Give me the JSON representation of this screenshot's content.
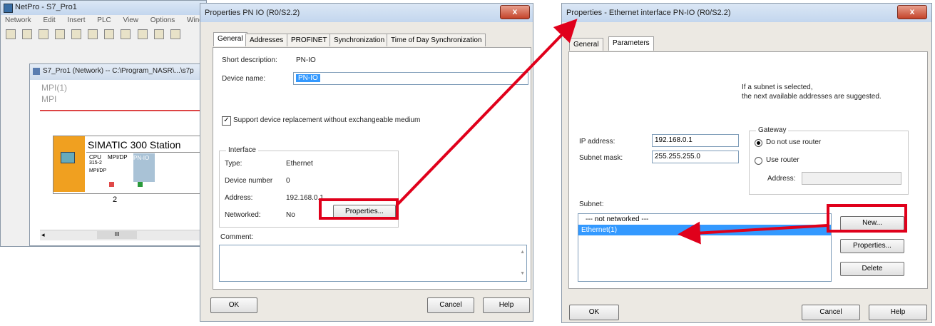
{
  "netpro": {
    "title": "NetPro - S7_Pro1",
    "menu": [
      "Network",
      "Edit",
      "Insert",
      "PLC",
      "View",
      "Options",
      "Window"
    ],
    "subwindow_title": "S7_Pro1 (Network) -- C:\\Program_NASR\\...\\s7p",
    "mpi_label": "MPI(1)",
    "mpi_sub": "MPI",
    "station_title": "SIMATIC 300 Station",
    "module_cpu": "CPU",
    "module_cpu_sub": "315-2",
    "module_mpidp": "MPI/DP",
    "module_mpidp2": "MPI/DP",
    "module_pnio": "PN-IO",
    "slot_number": "2",
    "scroll_thumb": "III"
  },
  "dialog1": {
    "title": "Properties  PN IO (R0/S2.2)",
    "close": "x",
    "tabs": [
      "General",
      "Addresses",
      "PROFINET",
      "Synchronization",
      "Time of Day Synchronization"
    ],
    "short_desc_label": "Short description:",
    "short_desc_value": "PN-IO",
    "device_name_label": "Device name:",
    "device_name_value": "PN-IO",
    "support_checkbox_label": "Support device replacement without exchangeable medium",
    "interface_group": "Interface",
    "type_label": "Type:",
    "type_value": "Ethernet",
    "devnum_label": "Device number",
    "devnum_value": "0",
    "address_label": "Address:",
    "address_value": "192.168.0.1",
    "networked_label": "Networked:",
    "networked_value": "No",
    "properties_button": "Properties...",
    "comment_label": "Comment:",
    "ok_button": "OK",
    "cancel_button": "Cancel",
    "help_button": "Help"
  },
  "dialog2": {
    "title": "Properties - Ethernet interface  PN-IO (R0/S2.2)",
    "close": "x",
    "tabs": [
      "General",
      "Parameters"
    ],
    "subnet_hint_line1": "If a subnet is selected,",
    "subnet_hint_line2": "the next available addresses are suggested.",
    "ip_label": "IP address:",
    "ip_value": "192.168.0.1",
    "mask_label": "Subnet mask:",
    "mask_value": "255.255.255.0",
    "gateway_group": "Gateway",
    "no_router_label": "Do not use router",
    "use_router_label": "Use router",
    "gw_address_label": "Address:",
    "subnet_label": "Subnet:",
    "subnet_items": [
      "--- not networked ---",
      "Ethernet(1)"
    ],
    "new_button": "New...",
    "properties_button": "Properties...",
    "delete_button": "Delete",
    "ok_button": "OK",
    "cancel_button": "Cancel",
    "help_button": "Help"
  },
  "colors": {
    "highlight_red": "#e0001b",
    "selection_blue": "#3399ff",
    "cpu_orange": "#f0a020",
    "mpi_line": "#d44"
  }
}
